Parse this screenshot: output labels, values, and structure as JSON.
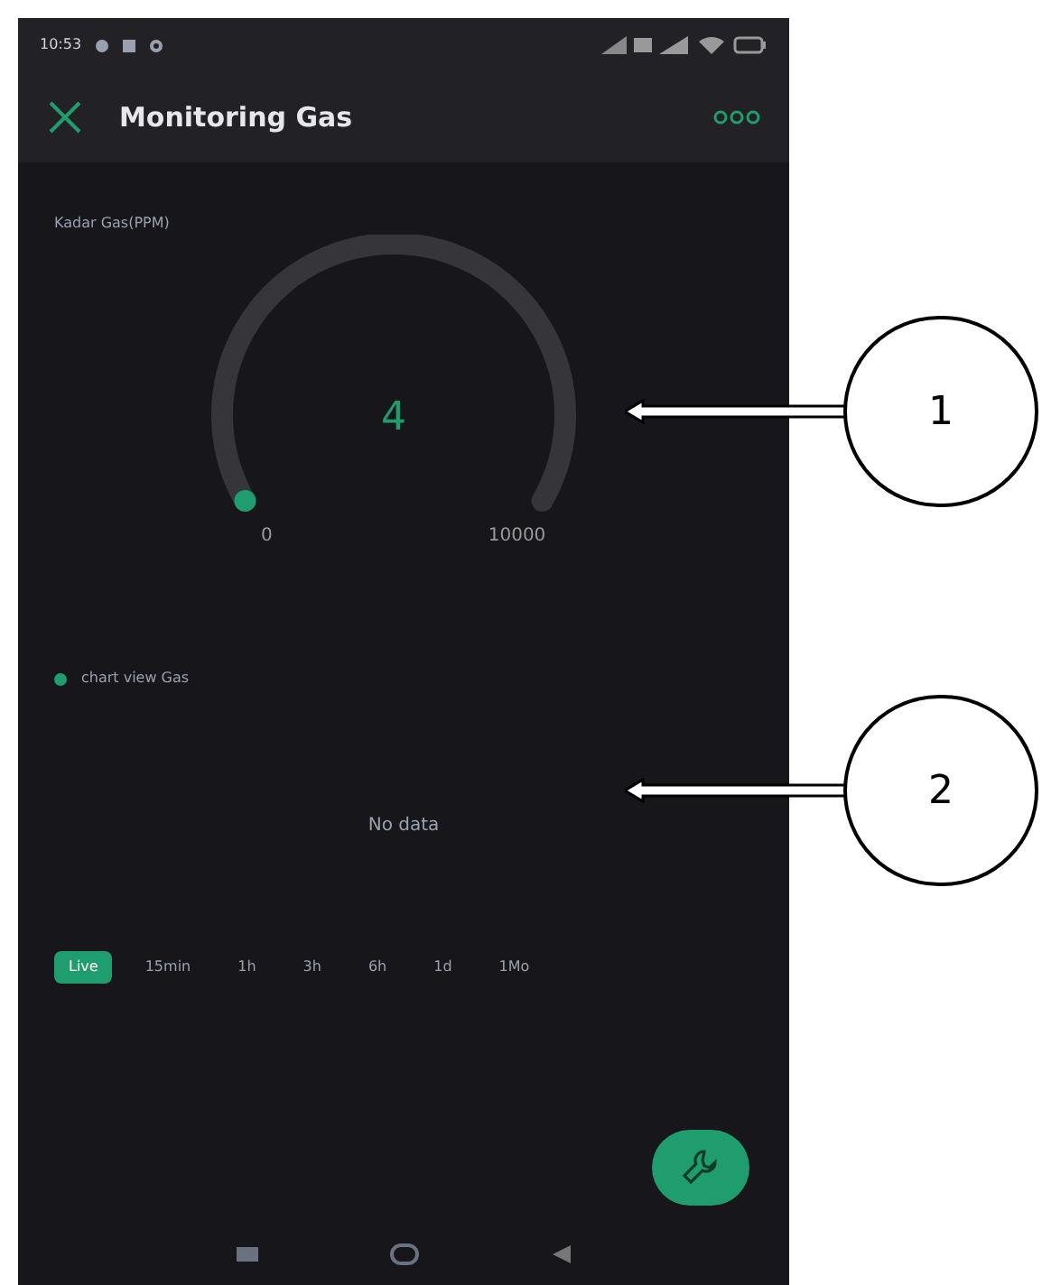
{
  "status_bar": {
    "time": "10:53"
  },
  "app_bar": {
    "title": "Monitoring Gas"
  },
  "gauge": {
    "label": "Kadar Gas(PPM)",
    "value": "4",
    "min": "0",
    "max": "10000"
  },
  "chart": {
    "legend": "chart view Gas",
    "empty_message": "No data",
    "ranges": [
      {
        "label": "Live",
        "selected": true
      },
      {
        "label": "15min",
        "selected": false
      },
      {
        "label": "1h",
        "selected": false
      },
      {
        "label": "3h",
        "selected": false
      },
      {
        "label": "6h",
        "selected": false
      },
      {
        "label": "1d",
        "selected": false
      },
      {
        "label": "1Mo",
        "selected": false
      }
    ]
  },
  "callouts": [
    "1",
    "2"
  ]
}
